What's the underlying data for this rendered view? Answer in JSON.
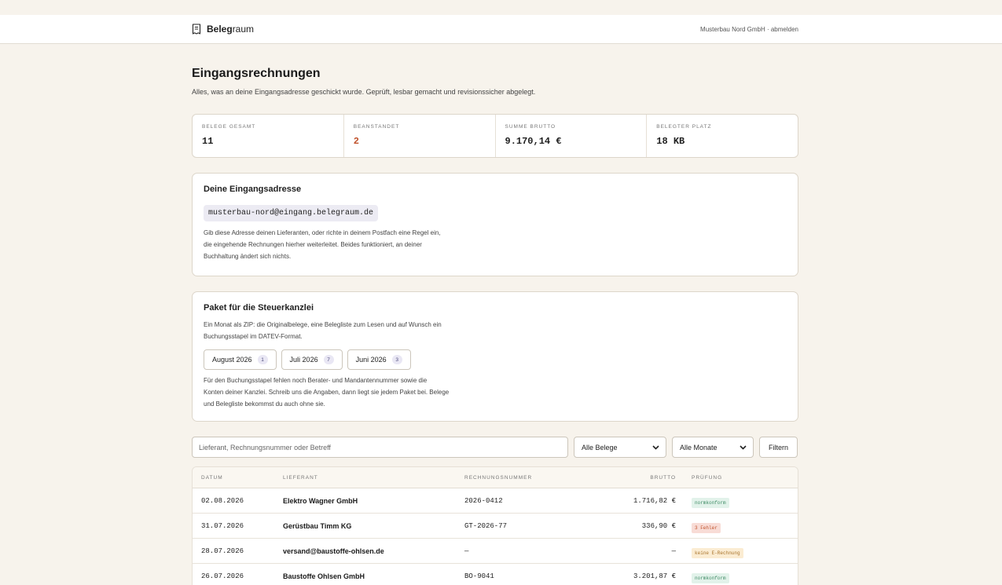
{
  "header": {
    "logo_bold": "Beleg",
    "logo_rest": "raum",
    "account": "Musterbau Nord GmbH · abmelden"
  },
  "page": {
    "title": "Eingangsrechnungen",
    "subtitle": "Alles, was an deine Eingangsadresse geschickt wurde. Geprüft, lesbar gemacht und revisionssicher abgelegt."
  },
  "stats": [
    {
      "label": "BELEGE GESAMT",
      "value": "11",
      "status": "normal"
    },
    {
      "label": "BEANSTANDET",
      "value": "2",
      "status": "alert"
    },
    {
      "label": "SUMME BRUTTO",
      "value": "9.170,14 €",
      "status": "normal"
    },
    {
      "label": "BELEGTER PLATZ",
      "value": "18 KB",
      "status": "normal"
    }
  ],
  "address_card": {
    "title": "Deine Eingangsadresse",
    "email": "musterbau-nord@eingang.belegraum.de",
    "text_lines": [
      "Gib diese Adresse deinen Lieferanten, oder richte in deinem Postfach eine Regel ein,",
      "die eingehende Rechnungen hierher weiterleitet. Beides funktioniert, an deiner",
      "Buchhaltung ändert sich nichts."
    ]
  },
  "package_card": {
    "title": "Paket für die Steuerkanzlei",
    "intro_lines": [
      "Ein Monat als ZIP: die Originalbelege, eine Belegliste zum Lesen und auf Wunsch ein",
      "Buchungsstapel im DATEV-Format."
    ],
    "months": [
      {
        "label": "August 2026",
        "count": "1"
      },
      {
        "label": "Juli 2026",
        "count": "7"
      },
      {
        "label": "Juni 2026",
        "count": "3"
      }
    ],
    "note_lines": [
      "Für den Buchungsstapel fehlen noch Berater- und Mandantennummer sowie die",
      "Konten deiner Kanzlei. Schreib uns die Angaben, dann liegt sie jedem Paket bei. Belege",
      "und Belegliste bekommst du auch ohne sie."
    ]
  },
  "filters": {
    "search_placeholder": "Lieferant, Rechnungsnummer oder Betreff",
    "search_value": "",
    "type_select": "Alle Belege",
    "month_select": "Alle Monate",
    "filter_button": "Filtern"
  },
  "table": {
    "columns": [
      "DATUM",
      "LIEFERANT",
      "RECHNUNGSNUMMER",
      "BRUTTO",
      "PRÜFUNG"
    ],
    "rows": [
      {
        "date": "02.08.2026",
        "supplier": "Elektro Wagner GmbH",
        "number": "2026-0412",
        "gross": "1.716,82 €",
        "check": "normkonform",
        "check_status": "ok"
      },
      {
        "date": "31.07.2026",
        "supplier": "Gerüstbau Timm KG",
        "number": "GT-2026-77",
        "gross": "336,90 €",
        "check": "3 Fehler",
        "check_status": "err"
      },
      {
        "date": "28.07.2026",
        "supplier": "versand@baustoffe-ohlsen.de",
        "number": "—",
        "gross": "—",
        "check": "keine E-Rechnung",
        "check_status": "warn"
      },
      {
        "date": "26.07.2026",
        "supplier": "Baustoffe Ohlsen GmbH",
        "number": "BO-9041",
        "gross": "3.201,87 €",
        "check": "normkonform",
        "check_status": "ok"
      }
    ]
  }
}
